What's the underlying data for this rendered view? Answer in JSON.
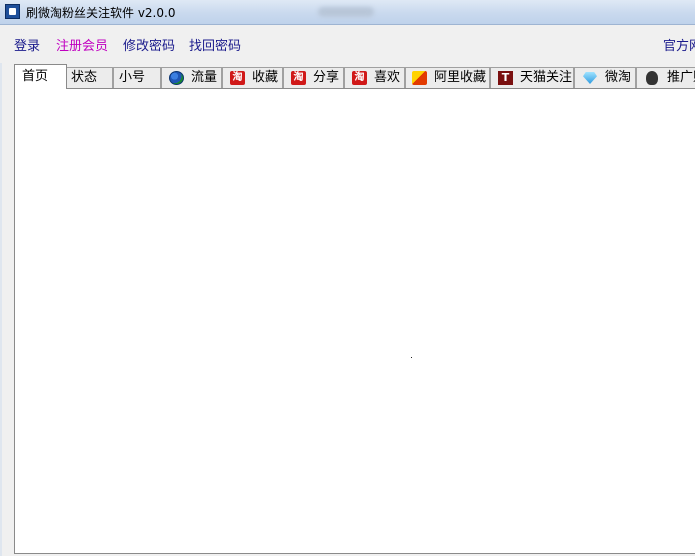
{
  "window": {
    "title": "刷微淘粉丝关注软件 v2.0.0"
  },
  "menu": {
    "login": "登录",
    "register": "注册会员",
    "change_password": "修改密码",
    "recover_password": "找回密码",
    "official_site": "官方网"
  },
  "tabs": [
    {
      "label": "首页",
      "icon": ""
    },
    {
      "label": "状态",
      "icon": ""
    },
    {
      "label": "小号",
      "icon": ""
    },
    {
      "label": "流量",
      "icon": "globe-icon"
    },
    {
      "label": "收藏",
      "icon": "taobao-icon",
      "glyph": "淘"
    },
    {
      "label": "分享",
      "icon": "taobao-icon",
      "glyph": "淘"
    },
    {
      "label": "喜欢",
      "icon": "taobao-icon",
      "glyph": "淘"
    },
    {
      "label": "阿里收藏",
      "icon": "alibaba-icon"
    },
    {
      "label": "天猫关注",
      "icon": "tmall-icon",
      "glyph": "T"
    },
    {
      "label": "微淘",
      "icon": "diamond-icon"
    },
    {
      "label": "推广赚",
      "icon": "person-icon"
    }
  ],
  "active_tab": "首页"
}
